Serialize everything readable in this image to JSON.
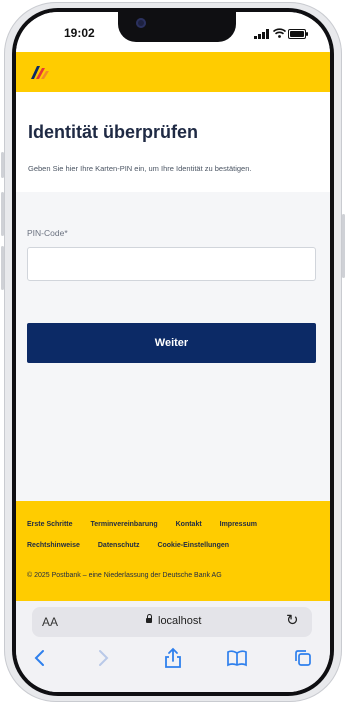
{
  "status_bar": {
    "time": "19:02"
  },
  "brand": {
    "primary": "#ffcc00",
    "navy": "#0c2a66"
  },
  "page": {
    "title": "Identität überprüfen",
    "subtitle": "Geben Sie hier Ihre Karten-PIN ein, um Ihre Identität zu bestätigen."
  },
  "form": {
    "pin_label": "PIN-Code*",
    "pin_value": "",
    "submit_label": "Weiter"
  },
  "footer": {
    "links_row1": [
      "Erste Schritte",
      "Terminvereinbarung",
      "Kontakt",
      "Impressum"
    ],
    "links_row2": [
      "Rechtshinweise",
      "Datenschutz",
      "Cookie-Einstellungen"
    ],
    "copyright": "© 2025 Postbank – eine Niederlassung der Deutsche Bank AG"
  },
  "browser": {
    "aa_label": "AA",
    "url": "localhost",
    "icons": [
      "back-icon",
      "forward-icon",
      "share-icon",
      "bookmarks-icon",
      "tabs-icon"
    ]
  }
}
